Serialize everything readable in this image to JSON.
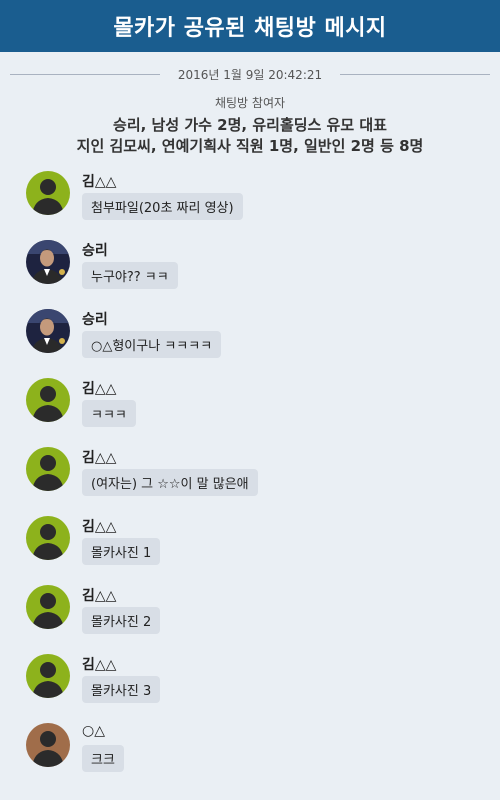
{
  "header": {
    "title": "몰카가 공유된 채팅방 메시지"
  },
  "date": "2016년 1월 9일 20:42:21",
  "participants": {
    "title": "채팅방 참여자",
    "line1": "승리, 남성 가수 2명, 유리홀딩스 유모 대표",
    "line2": "지인 김모씨, 연예기획사 직원 1명, 일반인 2명 등 8명"
  },
  "colors": {
    "header": "#1a5d8f",
    "background": "#eaeff4",
    "bubble": "#d8dee6",
    "avatar_green": "#8db21c",
    "avatar_brown": "#a06d4a"
  },
  "messages": [
    {
      "sender": "김△△",
      "text": "첨부파일(20초 짜리 영상)",
      "avatar": "default-green-avatar"
    },
    {
      "sender": "승리",
      "text": "누구야?? ㅋㅋ",
      "avatar": "photo-avatar"
    },
    {
      "sender": "승리",
      "text": "○△형이구나 ㅋㅋㅋㅋ",
      "avatar": "photo-avatar"
    },
    {
      "sender": "김△△",
      "text": "ㅋㅋㅋ",
      "avatar": "default-green-avatar"
    },
    {
      "sender": "김△△",
      "text": "(여자는) 그 ☆☆이 말 많은애",
      "avatar": "default-green-avatar"
    },
    {
      "sender": "김△△",
      "text": "몰카사진 1",
      "avatar": "default-green-avatar"
    },
    {
      "sender": "김△△",
      "text": "몰카사진 2",
      "avatar": "default-green-avatar"
    },
    {
      "sender": "김△△",
      "text": "몰카사진 3",
      "avatar": "default-green-avatar"
    },
    {
      "sender": "○△",
      "text": "크크",
      "avatar": "default-brown-avatar"
    }
  ]
}
